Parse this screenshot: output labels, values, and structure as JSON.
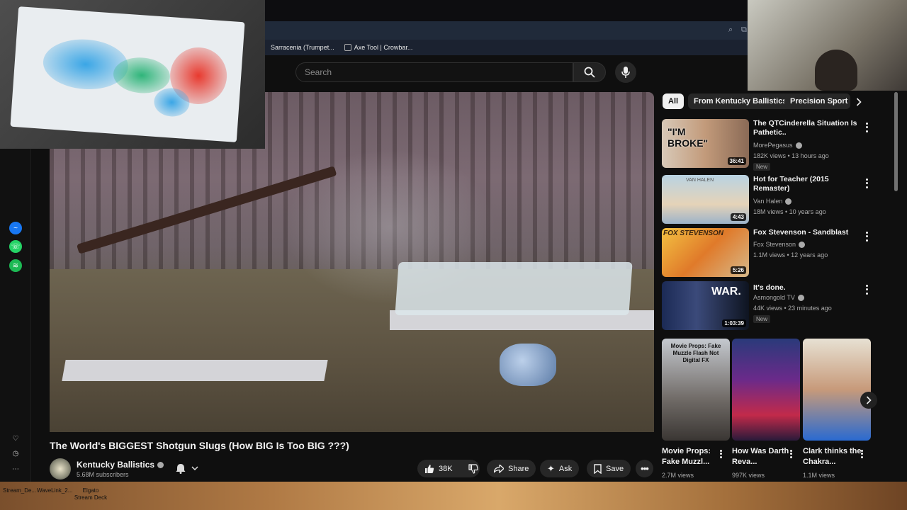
{
  "browser": {
    "bookmarks": [
      {
        "label": "Sarracenia (Trumpet..."
      },
      {
        "label": "Axe Tool | Crowbar..."
      }
    ]
  },
  "search": {
    "placeholder": "Search"
  },
  "video": {
    "title": "The World's BIGGEST Shotgun Slugs (How BIG Is Too BIG ???)",
    "channel": "Kentucky Ballistics",
    "subscribers": "5.68M subscribers",
    "likes": "38K",
    "share_label": "Share",
    "ask_label": "Ask",
    "save_label": "Save"
  },
  "chips": [
    {
      "label": "All"
    },
    {
      "label": "From Kentucky Ballistics"
    },
    {
      "label": "Precision Sport"
    }
  ],
  "recommendations": [
    {
      "title": "The QTCinderella Situation Is Pathetic..",
      "channel": "MorePegasus",
      "meta": "182K views • 13 hours ago",
      "duration": "36:41",
      "badge": "New",
      "thumb_text": "\"I'M BROKE\""
    },
    {
      "title": "Hot for Teacher (2015 Remaster)",
      "channel": "Van Halen",
      "meta": "18M views • 10 years ago",
      "duration": "4:43",
      "badge": "",
      "thumb_text": "VAN HALEN"
    },
    {
      "title": "Fox Stevenson - Sandblast",
      "channel": "Fox Stevenson",
      "meta": "1.1M views • 12 years ago",
      "duration": "5:26",
      "badge": "",
      "thumb_text": "FOX STEVENSON"
    },
    {
      "title": "It's done.",
      "channel": "Asmongold TV",
      "meta": "44K views • 23 minutes ago",
      "duration": "1:03:39",
      "badge": "New",
      "thumb_text": "WAR."
    }
  ],
  "shorts": [
    {
      "title": "Movie Props: Fake Muzzl...",
      "views": "2.7M views",
      "thumb_text": "Movie Props: Fake Muzzle Flash Not Digital FX"
    },
    {
      "title": "How Was Darth Reva...",
      "views": "997K views",
      "thumb_text": ""
    },
    {
      "title": "Clark thinks the Chakra...",
      "views": "1.1M views",
      "thumb_text": ""
    }
  ],
  "taskbar": {
    "items": [
      "Stream_De...",
      "WaveLink_2...",
      "Elgato Stream Deck"
    ]
  },
  "colors": {
    "background": "#0f0f0f",
    "chip_active": "#f1f1f1",
    "pill": "#272727",
    "messenger": "#1877f2",
    "whatsapp": "#25d366",
    "spotify": "#1db954"
  }
}
